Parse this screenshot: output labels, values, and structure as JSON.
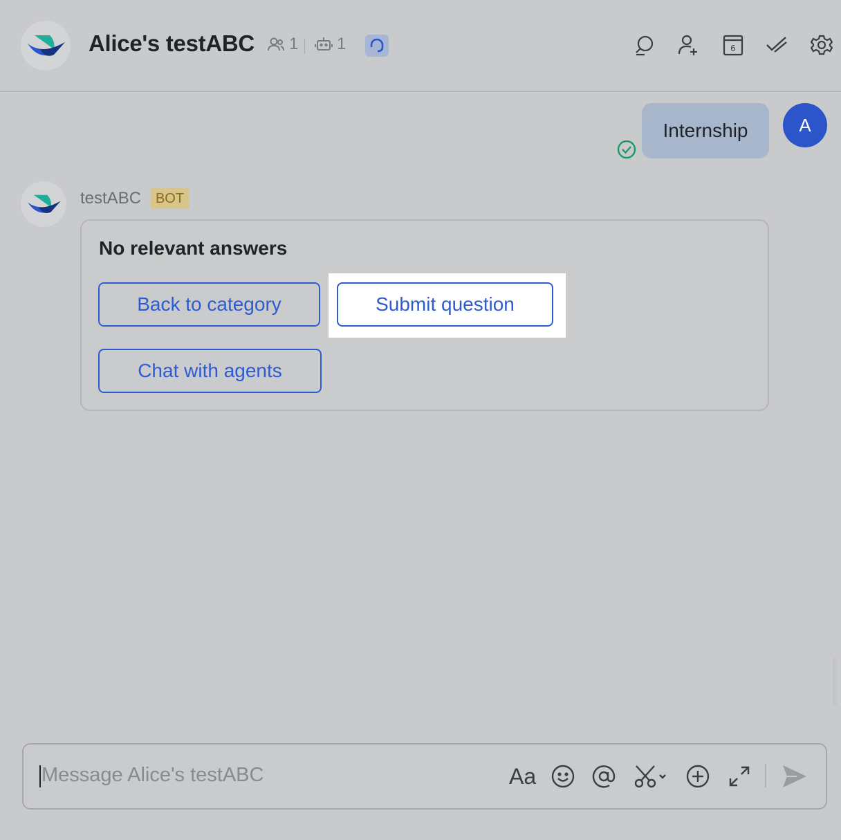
{
  "header": {
    "title": "Alice's testABC",
    "member_count": "1",
    "bot_count": "1",
    "icons": [
      "search-icon",
      "add-member-icon",
      "calendar-icon",
      "done-icon",
      "settings-icon"
    ],
    "calendar_day": "6"
  },
  "messages": {
    "user_message": "Internship",
    "user_avatar_initial": "A",
    "bot_name": "testABC",
    "bot_badge": "BOT",
    "card_title": "No relevant answers",
    "actions": [
      "Back to category",
      "Submit question",
      "Chat with agents"
    ]
  },
  "composer": {
    "placeholder": "Message Alice's testABC",
    "icons": [
      "text-format-icon",
      "emoji-icon",
      "mention-icon",
      "screenshot-icon",
      "add-icon",
      "expand-icon",
      "send-icon"
    ],
    "format_label": "Aa"
  },
  "colors": {
    "accent": "#2f5bd2",
    "background": "#c9cacb",
    "user_bubble": "#a8b6cc",
    "bot_badge": "#d8c58c",
    "read_check": "#1a9a6e"
  }
}
